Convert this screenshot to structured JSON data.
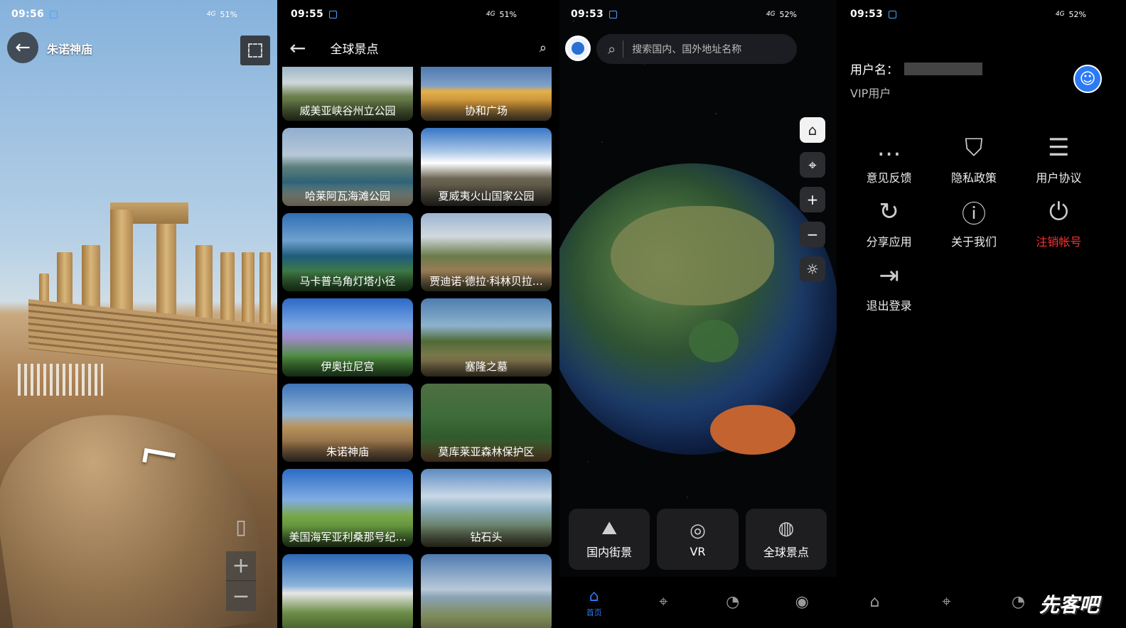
{
  "panel1": {
    "time": "09:56",
    "battery": "51%",
    "title": "朱诺神庙",
    "back_icon": "←",
    "plus": "+",
    "minus": "−"
  },
  "panel2": {
    "time": "09:55",
    "battery": "51%",
    "title": "全球景点",
    "back_icon": "←",
    "search_icon": "⌕",
    "spots": [
      "威美亚峡谷州立公园",
      "协和广场",
      "哈莱阿瓦海滩公园",
      "夏威夷火山国家公园",
      "马卡普乌角灯塔小径",
      "贾迪诺·德拉·科林贝拉…",
      "伊奥拉尼宫",
      "塞隆之墓",
      "朱诺神庙",
      "莫库莱亚森林保护区",
      "美国海军亚利桑那号纪…",
      "钻石头",
      "",
      ""
    ]
  },
  "panel3": {
    "time": "09:53",
    "battery": "52%",
    "search_placeholder": "搜索国内、国外地址名称",
    "search_icon": "⌕",
    "tools": [
      "⌂",
      "⌖",
      "+",
      "−",
      "☼"
    ],
    "quick": [
      {
        "icon": "⛰",
        "label": "国内街景"
      },
      {
        "icon": "◎",
        "label": "VR"
      },
      {
        "icon": "◍",
        "label": "全球景点"
      }
    ],
    "tabs": [
      {
        "icon": "⌂",
        "label": "首页"
      },
      {
        "icon": "⌖",
        "label": ""
      },
      {
        "icon": "◔",
        "label": ""
      },
      {
        "icon": "◉",
        "label": ""
      }
    ]
  },
  "panel4": {
    "time": "09:53",
    "battery": "52%",
    "username_label": "用户名：",
    "vip": "VIP用户",
    "menu": [
      {
        "icon": "…",
        "label": "意见反馈"
      },
      {
        "icon": "⛉",
        "label": "隐私政策"
      },
      {
        "icon": "☰",
        "label": "用户协议"
      },
      {
        "icon": "↻",
        "label": "分享应用"
      },
      {
        "icon": "ⓘ",
        "label": "关于我们"
      },
      {
        "icon": "⏻",
        "label": "注销帐号"
      },
      {
        "icon": "⇥",
        "label": "退出登录"
      }
    ],
    "tabs": [
      "⌂",
      "⌖",
      "◔",
      "◉"
    ],
    "watermark": "先客吧"
  },
  "colors": {
    "accent": "#2b7af6",
    "danger": "#ff3030"
  }
}
